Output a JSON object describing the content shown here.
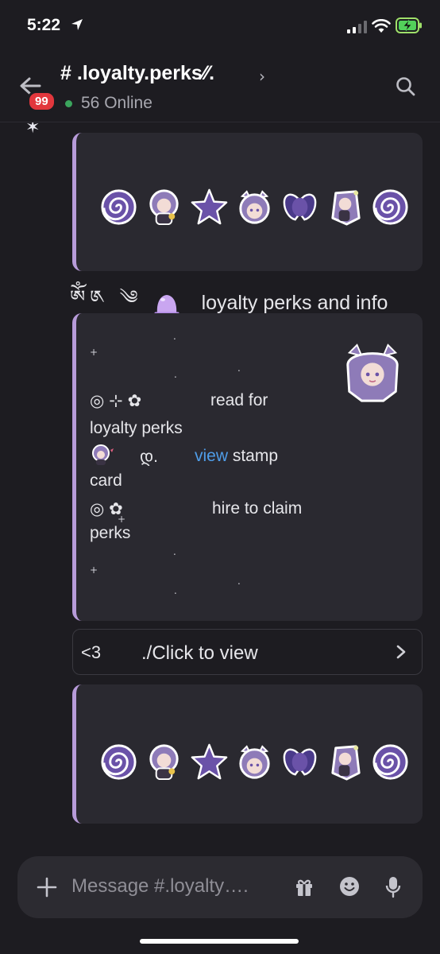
{
  "status_bar": {
    "time": "5:22",
    "icons": [
      "location-arrow-icon",
      "cellular-signal-icon",
      "wifi-icon",
      "battery-charging-icon"
    ]
  },
  "header": {
    "back_icon": "arrow-left-icon",
    "unread_badge": "99",
    "channel_name": "# .loyalty.perks⁄⁄.",
    "chevron_icon": "chevron-right-icon",
    "online_text": "56 Online",
    "online_dot_color": "#3ba55d",
    "search_icon": "search-icon"
  },
  "messages": {
    "info_line": {
      "glyphs": "ༀ༁ ༄",
      "emoji": "purple-jelly-icon",
      "text": "loyalty perks and info"
    },
    "main_embed": {
      "line1": "read for",
      "line2": "loyalty  perks",
      "line3_link": "view",
      "line3_rest": " stamp",
      "line4": "card",
      "line5": "hire to claim",
      "line6": "perks",
      "line1_prefix": "◎  ⊹  ✿",
      "line3_prefix": "დ.",
      "line5_prefix": "◎       ✿"
    },
    "view_button": {
      "left_text": "<3",
      "label": "./Click to view"
    },
    "sticker_row_icons": [
      "spiral-icon",
      "chibi-girl-icon",
      "star-icon",
      "chibi-face-icon",
      "bow-icon",
      "chibi-girl-pose-icon",
      "spiral-icon"
    ]
  },
  "composer": {
    "placeholder": "Message #.loyalty….",
    "icons": [
      "plus-icon",
      "gift-icon",
      "emoji-icon",
      "microphone-icon"
    ]
  },
  "colors": {
    "background": "#1d1c21",
    "embed_background": "#2a2930",
    "embed_accent": "#b79bd9",
    "link": "#4f9de8",
    "badge": "#e2373d",
    "sticker_purple": "#6a52a8"
  }
}
